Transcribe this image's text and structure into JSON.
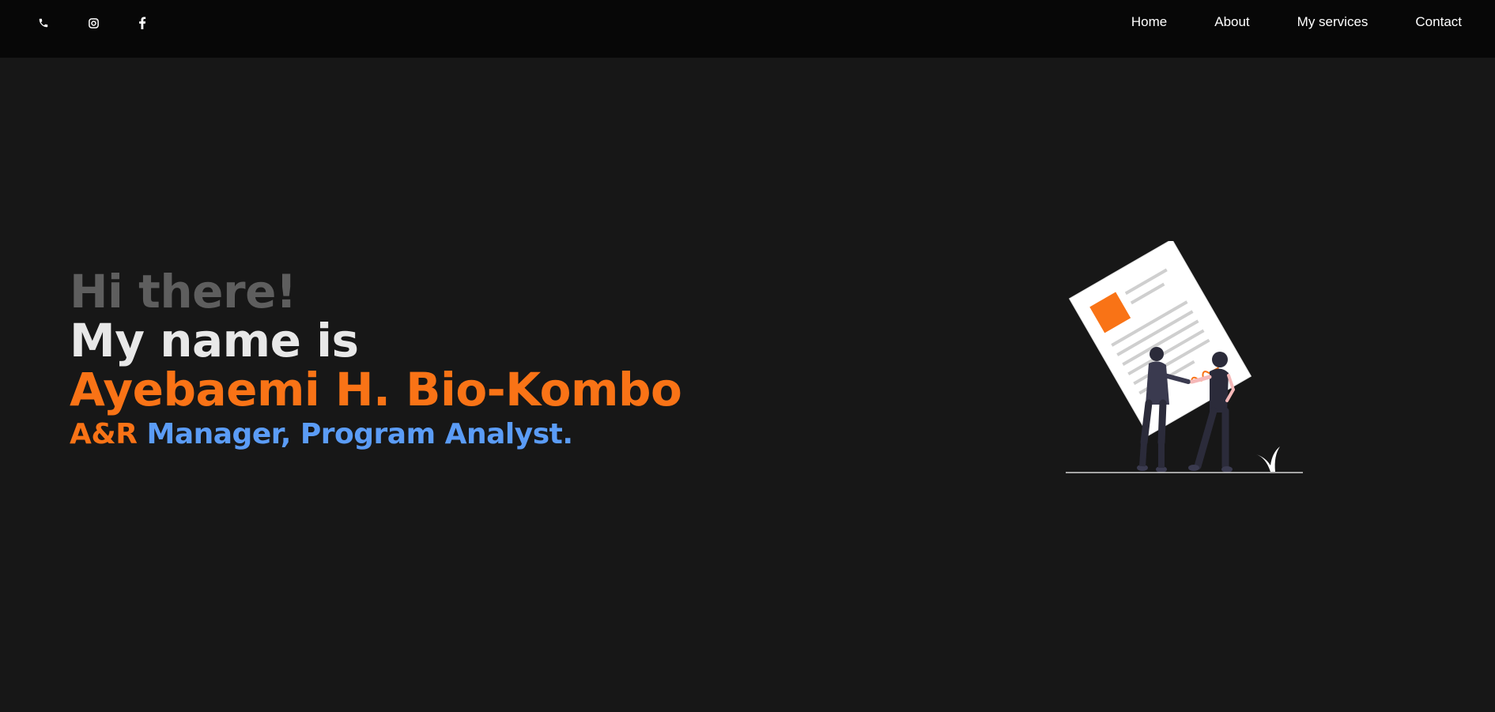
{
  "nav": {
    "social_icons": [
      "phone-icon",
      "instagram-icon",
      "facebook-icon"
    ],
    "links": [
      {
        "label": "Home"
      },
      {
        "label": "About"
      },
      {
        "label": "My services"
      },
      {
        "label": "Contact"
      }
    ]
  },
  "hero": {
    "greeting": "Hi there!",
    "intro": "My name is",
    "name": "Ayebaemi H. Bio-Kombo",
    "role_highlight": "A&R",
    "role_rest": " Manager, Program Analyst."
  },
  "colors": {
    "accent_orange": "#f97316",
    "accent_blue": "#5b9cf6",
    "background": "#171717",
    "navbar": "#070707"
  }
}
